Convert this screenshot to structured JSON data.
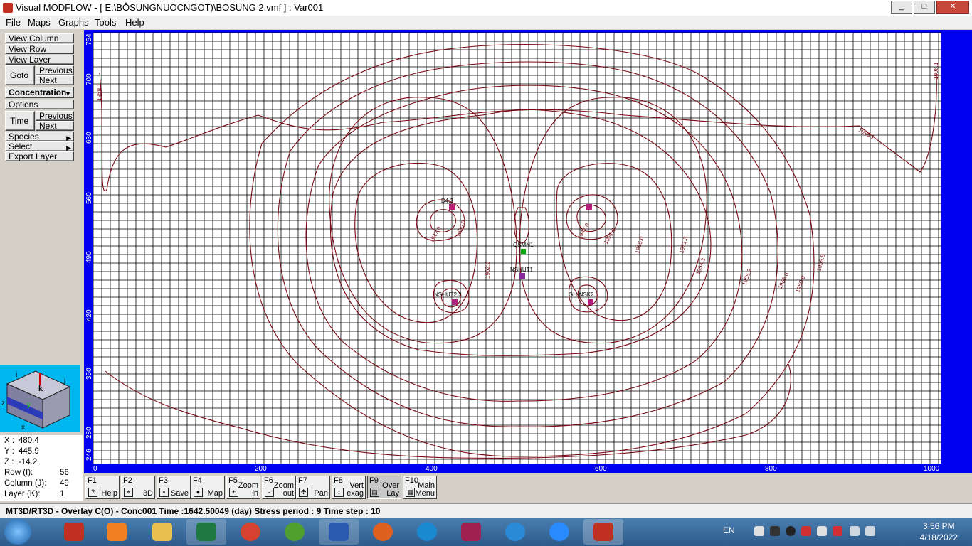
{
  "window": {
    "title": "Visual MODFLOW - [ E:\\BÔSUNGNUOCNGOT)\\BOSUNG 2.vmf ] : Var001",
    "min": "_",
    "max": "□",
    "close": "✕"
  },
  "menu": [
    "File",
    "Maps",
    "Graphs",
    "Tools",
    "Help"
  ],
  "left": {
    "view_column": "View Column",
    "view_row": "View Row",
    "view_layer": "View Layer",
    "goto": "Goto",
    "previous": "Previous",
    "next": "Next",
    "concentration": "Concentration",
    "options": "Options",
    "time": "Time",
    "previous2": "Previous",
    "next2": "Next",
    "species": "Species",
    "select": "Select",
    "export_layer": "Export Layer"
  },
  "cube": {
    "i": "i",
    "j": "j",
    "k": "k",
    "z": "z",
    "y": "y",
    "x": "x"
  },
  "coords": {
    "x_label": "X :",
    "x_value": "480.4",
    "y_label": "Y :",
    "y_value": "445.9",
    "z_label": "Z :",
    "z_value": "-14.2",
    "row_label": "Row    (I):",
    "row_value": "56",
    "col_label": "Column (J):",
    "col_value": "49",
    "layer_label": "Layer  (K):",
    "layer_value": "1"
  },
  "plot": {
    "x_ticks": [
      "0",
      "200",
      "400",
      "600",
      "800",
      "1000"
    ],
    "y_ticks": [
      "754",
      "700",
      "630",
      "560",
      "490",
      "420",
      "350",
      "280",
      "246"
    ],
    "wells": [
      "QSMN1",
      "NSHUT1",
      "NSHUT2.3",
      "GH-NSK2",
      "Đ4.3"
    ],
    "contour_labels": [
      "1959.1",
      "1998.1",
      "1998.1",
      "1947.0",
      "1950.0",
      "1947.0",
      "1951.0",
      "1962.0",
      "1955.0",
      "1951.3",
      "1954.3",
      "1955.2",
      "1956.6",
      "1955.8",
      "1950.0"
    ]
  },
  "fkeys": [
    {
      "k": "F1",
      "l": "Help",
      "icon": "?"
    },
    {
      "k": "F2",
      "l": "3D",
      "icon": "⌖"
    },
    {
      "k": "F3",
      "l": "Save",
      "icon": "▪"
    },
    {
      "k": "F4",
      "l": "Map",
      "icon": "●"
    },
    {
      "k": "F5",
      "l": "Zoom\nin",
      "icon": "+"
    },
    {
      "k": "F6",
      "l": "Zoom\nout",
      "icon": "-"
    },
    {
      "k": "F7",
      "l": "Pan",
      "icon": "✥"
    },
    {
      "k": "F8",
      "l": "Vert\nexag",
      "icon": "↕"
    },
    {
      "k": "F9",
      "l": "Over\nLay",
      "icon": "▤"
    },
    {
      "k": "F10",
      "l": "Main\nMenu",
      "icon": "▦"
    }
  ],
  "status": "MT3D/RT3D - Overlay C(O) - Conc001 Time :1642.50049 (day) Stress period : 9 Time step : 10",
  "tray": {
    "lang": "EN",
    "time": "3:56 PM",
    "date": "4/18/2022"
  },
  "colors": {
    "plot_border": "#0000f0",
    "contour": "#7a0a14",
    "grid": "#000000"
  }
}
